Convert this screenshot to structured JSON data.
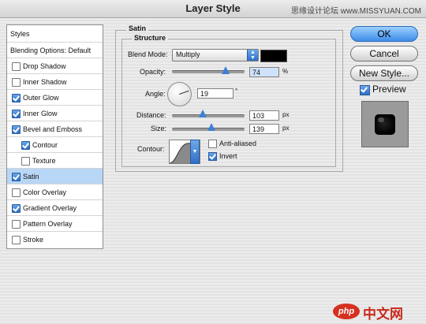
{
  "window": {
    "title": "Layer Style",
    "watermark": "思缘设计论坛 www.MISSYUAN.COM"
  },
  "styles_list": {
    "header": "Styles",
    "items": [
      {
        "label": "Blending Options: Default",
        "checkbox": false
      },
      {
        "label": "Drop Shadow",
        "checked": false
      },
      {
        "label": "Inner Shadow",
        "checked": false
      },
      {
        "label": "Outer Glow",
        "checked": true
      },
      {
        "label": "Inner Glow",
        "checked": true
      },
      {
        "label": "Bevel and Emboss",
        "checked": true
      },
      {
        "label": "Contour",
        "checked": true,
        "indent": true
      },
      {
        "label": "Texture",
        "checked": false,
        "indent": true
      },
      {
        "label": "Satin",
        "checked": true,
        "selected": true
      },
      {
        "label": "Color Overlay",
        "checked": false
      },
      {
        "label": "Gradient Overlay",
        "checked": true
      },
      {
        "label": "Pattern Overlay",
        "checked": false
      },
      {
        "label": "Stroke",
        "checked": false
      }
    ]
  },
  "satin": {
    "group_title": "Satin",
    "structure_title": "Structure",
    "blend_mode_label": "Blend Mode:",
    "blend_mode_value": "Multiply",
    "blend_color": "#000000",
    "opacity_label": "Opacity:",
    "opacity_value": "74",
    "opacity_unit": "%",
    "opacity_fraction": 0.74,
    "angle_label": "Angle:",
    "angle_value": "19",
    "angle_unit": "°",
    "distance_label": "Distance:",
    "distance_value": "103",
    "distance_unit": "px",
    "distance_fraction": 0.42,
    "size_label": "Size:",
    "size_value": "139",
    "size_unit": "px",
    "size_fraction": 0.54,
    "contour_label": "Contour:",
    "anti_aliased_label": "Anti-aliased",
    "anti_aliased_checked": false,
    "invert_label": "Invert",
    "invert_checked": true
  },
  "buttons": {
    "ok": "OK",
    "cancel": "Cancel",
    "new_style": "New Style...",
    "preview_label": "Preview",
    "preview_checked": true
  },
  "watermark_bottom": {
    "logo": "php",
    "text": "中文网"
  }
}
